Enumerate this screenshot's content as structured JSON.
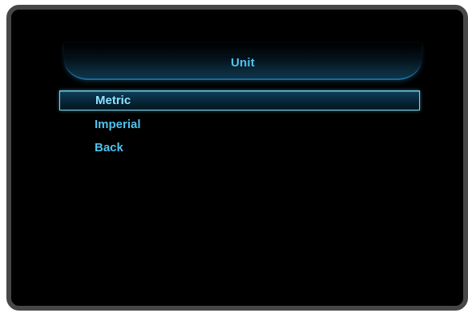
{
  "menu": {
    "title": "Unit",
    "items": [
      {
        "label": "Metric",
        "selected": true
      },
      {
        "label": "Imperial",
        "selected": false
      },
      {
        "label": "Back",
        "selected": false
      }
    ]
  },
  "colors": {
    "accent_text": "#4fc3ee",
    "selection_border": "#7fd6f2",
    "frame": "#474747",
    "background": "#000000"
  }
}
